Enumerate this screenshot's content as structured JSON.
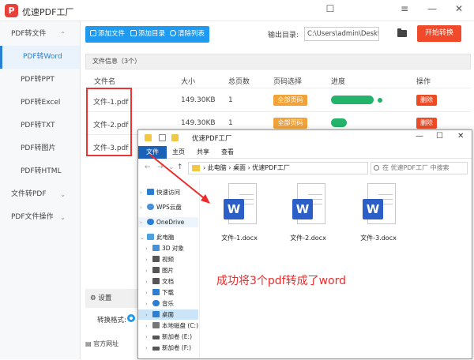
{
  "app": {
    "title": "优速PDF工厂",
    "logo": "P"
  },
  "window_controls": [
    "☐",
    "≡",
    "—",
    "✕"
  ],
  "sidebar": {
    "items": [
      {
        "label": "PDF转文件",
        "type": "group",
        "arrow": "⌃"
      },
      {
        "label": "PDF转Word",
        "type": "sub",
        "active": true
      },
      {
        "label": "PDF转PPT",
        "type": "sub"
      },
      {
        "label": "PDF转Excel",
        "type": "sub"
      },
      {
        "label": "PDF转TXT",
        "type": "sub"
      },
      {
        "label": "PDF转图片",
        "type": "sub"
      },
      {
        "label": "PDF转HTML",
        "type": "sub"
      },
      {
        "label": "文件转PDF",
        "type": "group",
        "arrow": "⌄"
      },
      {
        "label": "PDF文件操作",
        "type": "group",
        "arrow": "⌄"
      }
    ]
  },
  "toolbar": {
    "add_file": "添加文件",
    "add_dir": "添加目录",
    "clear_list": "清除列表"
  },
  "output": {
    "label": "输出目录:",
    "path": "C:\\Users\\admin\\Deskto"
  },
  "start_button": "开始转换",
  "file_info": "文件信息（3个）",
  "table": {
    "headers": [
      "文件名",
      "大小",
      "总页数",
      "页码选择",
      "进度",
      "操作"
    ],
    "rows": [
      {
        "name": "文件-1.pdf",
        "size": "149.30KB",
        "pages": "1",
        "page_sel": "全部页码",
        "action": "删除"
      },
      {
        "name": "文件-2.pdf",
        "size": "149.30KB",
        "pages": "1",
        "page_sel": "全部页码",
        "action": "删除"
      },
      {
        "name": "文件-3.pdf",
        "size": "149.30KB",
        "pages": "1",
        "page_sel": "",
        "action": ""
      }
    ]
  },
  "settings": {
    "title": "设置",
    "format_label": "转换格式:"
  },
  "official_site": "官方网址",
  "explorer": {
    "title": "优速PDF工厂",
    "menu": [
      "文件",
      "主页",
      "共享",
      "查看"
    ],
    "address": "› 此电脑 › 桌面 › 优速PDF工厂",
    "search_placeholder": "在 优速PDF工厂 中搜索",
    "tree": [
      {
        "label": "快速访问",
        "icon_color": "#2a7fd4",
        "chev": "›"
      },
      {
        "label": "WPS云盘",
        "icon_color": "#4a90d9",
        "chev": "›"
      },
      {
        "label": "OneDrive",
        "icon_color": "#2a7fd4",
        "chev": "›",
        "highlight": true
      },
      {
        "label": "此电脑",
        "icon_color": "#4aa3df",
        "chev": "⌄"
      },
      {
        "label": "3D 对象",
        "icon_color": "#4a90d9",
        "chev": "›"
      },
      {
        "label": "视频",
        "icon_color": "#555",
        "chev": "›"
      },
      {
        "label": "图片",
        "icon_color": "#555",
        "chev": "›"
      },
      {
        "label": "文档",
        "icon_color": "#555",
        "chev": "›"
      },
      {
        "label": "下载",
        "icon_color": "#2a7fd4",
        "chev": "›"
      },
      {
        "label": "音乐",
        "icon_color": "#2a7fd4",
        "chev": "›"
      },
      {
        "label": "桌面",
        "icon_color": "#2a7fd4",
        "chev": "›",
        "selected": true
      },
      {
        "label": "本地磁盘 (C:)",
        "icon_color": "#777",
        "chev": "›"
      },
      {
        "label": "新加卷 (E:)",
        "icon_color": "#555",
        "chev": "›"
      },
      {
        "label": "新加卷 (F:)",
        "icon_color": "#555",
        "chev": "›"
      }
    ],
    "files": [
      "文件-1.docx",
      "文件-2.docx",
      "文件-3.docx"
    ]
  },
  "annotation": "成功将3个pdf转成了word",
  "colors": {
    "accent": "#1e9bf0",
    "start": "#f04a2a",
    "annotation": "#ee2a2a",
    "word": "#2b5fc7"
  }
}
